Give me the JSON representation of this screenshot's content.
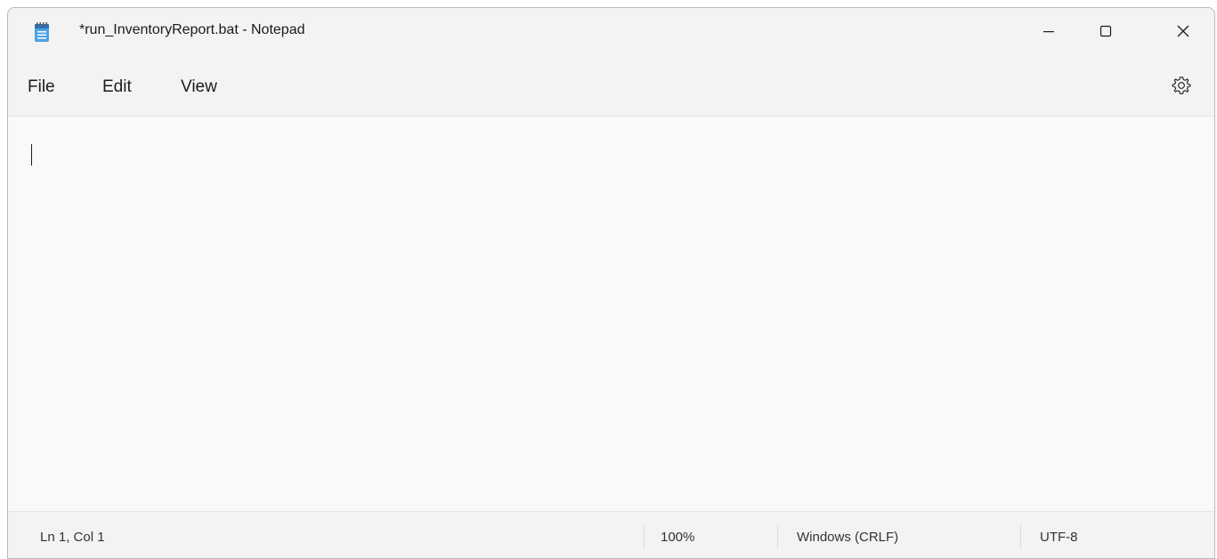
{
  "window": {
    "title": "*run_InventoryReport.bat - Notepad",
    "app_icon": "notepad-icon",
    "controls": {
      "minimize": "minimize-icon",
      "maximize": "maximize-icon",
      "close": "close-icon"
    }
  },
  "menubar": {
    "items": [
      {
        "label": "File"
      },
      {
        "label": "Edit"
      },
      {
        "label": "View"
      }
    ],
    "settings_icon": "gear-icon"
  },
  "editor": {
    "content": ""
  },
  "statusbar": {
    "position": "Ln 1, Col 1",
    "zoom": "100%",
    "line_endings": "Windows (CRLF)",
    "encoding": "UTF-8"
  },
  "colors": {
    "window_bg": "#f3f3f3",
    "editor_bg": "#f9f9f9",
    "icon_blue": "#3a8fd6"
  }
}
